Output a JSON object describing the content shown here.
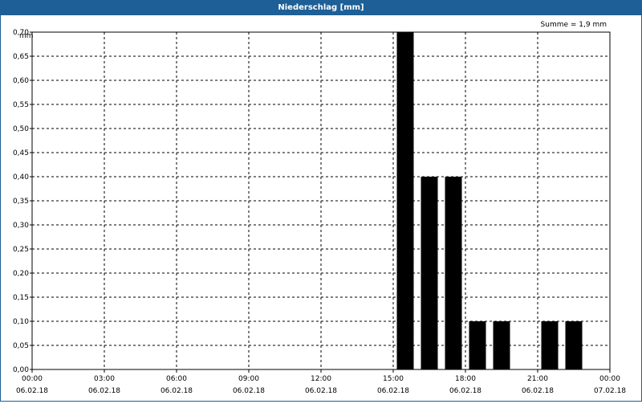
{
  "title": "Niederschlag [mm]",
  "chart_data": {
    "type": "bar",
    "title": "Niederschlag [mm]",
    "ylabel": "mm",
    "annotation": "Summe = 1,9 mm",
    "ylim": [
      0,
      0.7
    ],
    "y_ticks": [
      "0,00",
      "0,05",
      "0,10",
      "0,15",
      "0,20",
      "0,25",
      "0,30",
      "0,35",
      "0,40",
      "0,45",
      "0,50",
      "0,55",
      "0,60",
      "0,65",
      "0,70"
    ],
    "x_ticks": [
      {
        "time": "00:00",
        "date": "06.02.18"
      },
      {
        "time": "03:00",
        "date": "06.02.18"
      },
      {
        "time": "06:00",
        "date": "06.02.18"
      },
      {
        "time": "09:00",
        "date": "06.02.18"
      },
      {
        "time": "12:00",
        "date": "06.02.18"
      },
      {
        "time": "15:00",
        "date": "06.02.18"
      },
      {
        "time": "18:00",
        "date": "06.02.18"
      },
      {
        "time": "21:00",
        "date": "06.02.18"
      },
      {
        "time": "00:00",
        "date": "07.02.18"
      }
    ],
    "x_range": [
      "06.02.18 00:00",
      "07.02.18 00:00"
    ],
    "bar_color": "#000000",
    "grid": true,
    "series": [
      {
        "points": [
          {
            "x": "06.02.18 15:00",
            "y": 0.7
          },
          {
            "x": "06.02.18 16:00",
            "y": 0.4
          },
          {
            "x": "06.02.18 17:00",
            "y": 0.4
          },
          {
            "x": "06.02.18 18:00",
            "y": 0.1
          },
          {
            "x": "06.02.18 19:00",
            "y": 0.1
          },
          {
            "x": "06.02.18 21:00",
            "y": 0.1
          },
          {
            "x": "06.02.18 22:00",
            "y": 0.1
          }
        ]
      }
    ]
  }
}
